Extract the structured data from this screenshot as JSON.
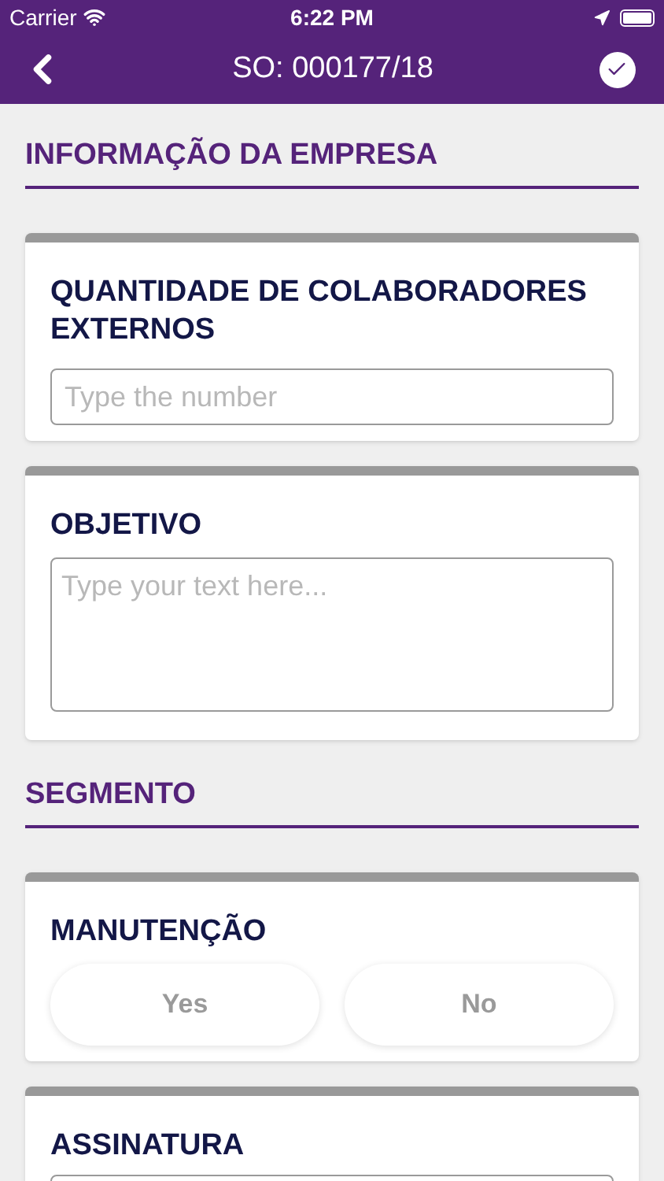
{
  "status_bar": {
    "carrier": "Carrier",
    "time": "6:22 PM"
  },
  "nav": {
    "title": "SO: 000177/18"
  },
  "sections": [
    {
      "title": "INFORMAÇÃO DA EMPRESA",
      "cards": [
        {
          "kind": "input",
          "label": "QUANTIDADE DE COLABORADORES EXTERNOS",
          "placeholder": "Type the number"
        },
        {
          "kind": "textarea",
          "label": "OBJETIVO",
          "placeholder": "Type your text here..."
        }
      ]
    },
    {
      "title": "SEGMENTO",
      "cards": [
        {
          "kind": "choice",
          "label": "MANUTENÇÃO",
          "options": [
            {
              "label": "Yes",
              "selected": false
            },
            {
              "label": "No",
              "selected": false
            }
          ]
        },
        {
          "kind": "signature",
          "label": "ASSINATURA"
        }
      ]
    }
  ]
}
